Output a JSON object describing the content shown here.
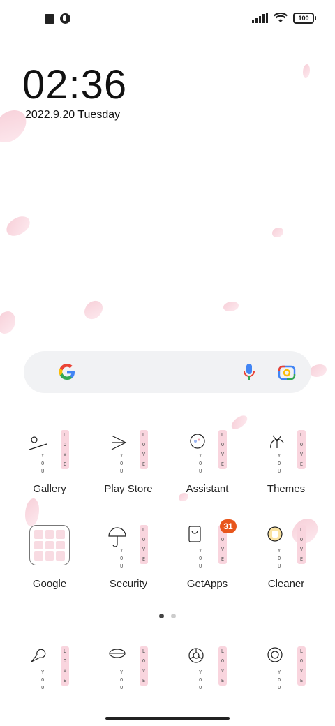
{
  "status_bar": {
    "battery": "100",
    "left_icons": [
      "stop-square-icon",
      "notification-app-icon"
    ],
    "right_icons": [
      "signal-icon",
      "wifi-icon",
      "battery-icon"
    ]
  },
  "clock": {
    "time": "02:36",
    "date": "2022.9.20 Tuesday"
  },
  "search_bar": {
    "icons": [
      "google-g-icon",
      "microphone-icon",
      "google-lens-icon"
    ]
  },
  "apps": [
    {
      "label": "Gallery"
    },
    {
      "label": "Play Store"
    },
    {
      "label": "Assistant"
    },
    {
      "label": "Themes"
    },
    {
      "label": "Google"
    },
    {
      "label": "Security"
    },
    {
      "label": "GetApps",
      "badge": "31"
    },
    {
      "label": "Cleaner"
    }
  ],
  "dock": {
    "icons": [
      "messages-icon",
      "chat-icon",
      "chrome-icon",
      "camera-icon"
    ]
  },
  "page_indicator": {
    "pages": 2,
    "active": 1
  },
  "theme_icon_text": {
    "love": [
      "L",
      "O",
      "V",
      "E"
    ],
    "you": [
      "Y",
      "O",
      "U"
    ]
  },
  "colors": {
    "badge": "#e8561c",
    "accent_pink": "#f6c9d3"
  }
}
